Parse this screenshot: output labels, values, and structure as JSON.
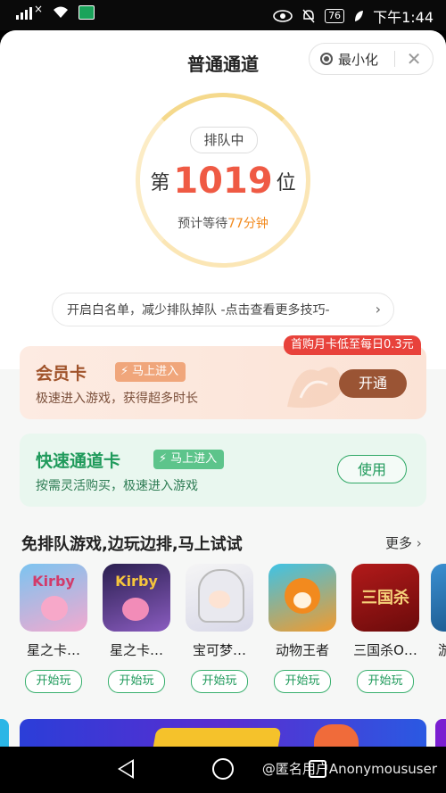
{
  "status_bar": {
    "left_signal": "×",
    "right_badge": "76",
    "time": "下午1:44"
  },
  "header": {
    "title": "普通通道",
    "minimize_label": "最小化",
    "close_glyph": "✕"
  },
  "queue": {
    "status": "排队中",
    "prefix": "第",
    "position": "1019",
    "suffix": "位",
    "wait_prefix": "预计等待",
    "wait_minutes": "77分钟"
  },
  "tip": {
    "text": "开启白名单，减少排队掉队  -点击查看更多技巧-",
    "chevron": "›"
  },
  "vip_card": {
    "title": "会员卡",
    "tag": "马上进入",
    "subtitle": "极速进入游戏，获得超多时长",
    "button": "开通",
    "promo": "首购月卡低至每日0.3元"
  },
  "fast_card": {
    "title": "快速通道卡",
    "tag": "马上进入",
    "subtitle": "按需灵活购买，极速进入游戏",
    "button": "使用"
  },
  "section": {
    "title": "免排队游戏,边玩边排,马上试试",
    "more": "更多",
    "more_chevron": "›"
  },
  "games": [
    {
      "name": "星之卡…",
      "play": "开始玩",
      "icon_text": "Kirby"
    },
    {
      "name": "星之卡…",
      "play": "开始玩",
      "icon_text": "Kirby"
    },
    {
      "name": "宝可梦…",
      "play": "开始玩",
      "icon_text": ""
    },
    {
      "name": "动物王者",
      "play": "开始玩",
      "icon_text": ""
    },
    {
      "name": "三国杀O…",
      "play": "开始玩",
      "icon_text": "三国杀"
    },
    {
      "name": "游",
      "play": "",
      "icon_text": ""
    }
  ],
  "nav": {
    "watermark": "@匿名用户Anonymoususer"
  }
}
